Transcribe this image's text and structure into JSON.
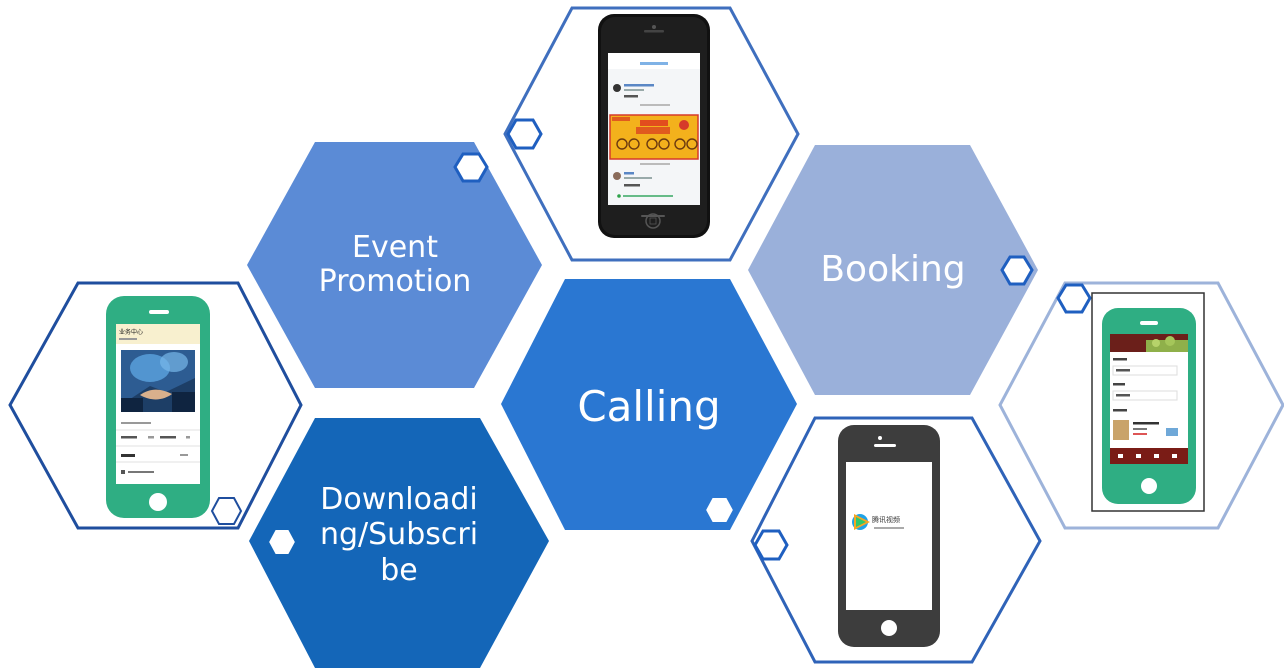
{
  "colors": {
    "event_promotion": "#5B8BD6",
    "calling": "#2A77D2",
    "downloading": "#1466B8",
    "booking": "#9AB0DA",
    "outline_dark": "#2E5FAE",
    "outline_light": "#8FA8D4",
    "phone_green": "#2FAE83",
    "phone_dark": "#3D3D3D",
    "phone_black": "#111111"
  },
  "hexagons": {
    "event_promotion": {
      "lines": [
        "Event",
        "Promotion"
      ]
    },
    "calling": {
      "lines": [
        "Calling"
      ]
    },
    "downloading": {
      "lines": [
        "Downloadi",
        "ng/Subscri",
        "be"
      ]
    },
    "booking": {
      "lines": [
        "Booking"
      ]
    }
  },
  "phones": {
    "left_phone": {
      "title": "业务中心",
      "icon": "handshake-image"
    },
    "top_phone": {
      "icon": "chat-feed-with-glasses-banner"
    },
    "bottom_phone": {
      "icon": "video-app-logo",
      "logo_text": "腾讯视频"
    },
    "right_phone": {
      "icon": "booking-form"
    }
  }
}
